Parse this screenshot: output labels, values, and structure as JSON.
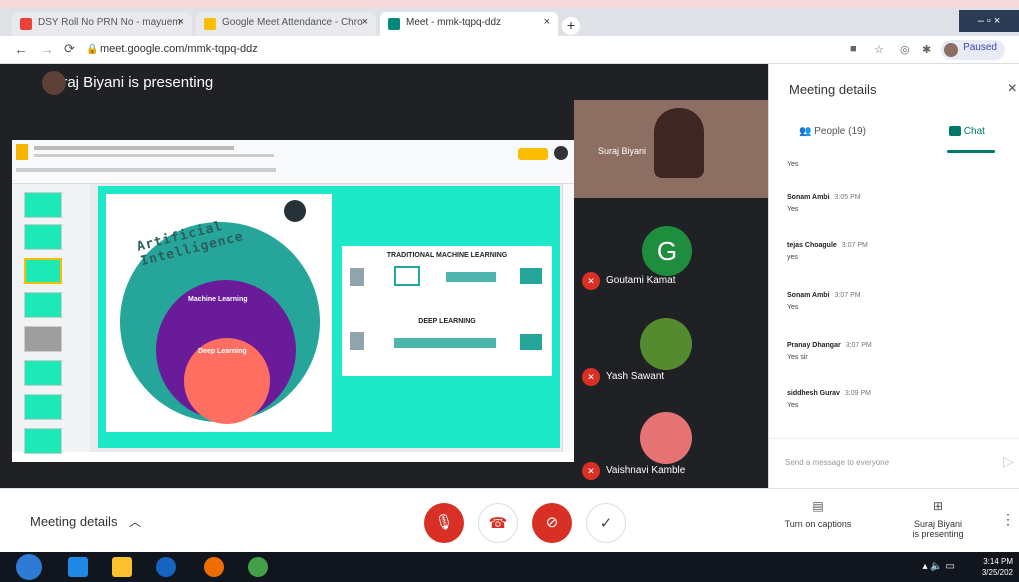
{
  "browser": {
    "tabs": [
      {
        "title": "DSY Roll No PRN No - mayuem"
      },
      {
        "title": "Google Meet Attendance - Chro"
      },
      {
        "title": "Meet - mmk-tqpq-ddz"
      }
    ],
    "new_tab": "+",
    "window_controls": "– ▫ ×",
    "url": "meet.google.com/mmk-tqpq-ddz",
    "profile_status": "Paused"
  },
  "meet": {
    "presenting_banner": "Suraj Biyani is presenting",
    "participants": [
      {
        "name": "Suraj Biyani"
      },
      {
        "name": "Goutami Kamat",
        "initial": "G"
      },
      {
        "name": "Yash Sawant"
      },
      {
        "name": "Vaishnavi Kamble"
      }
    ],
    "slide": {
      "title": "Artificial Intelligence",
      "inner_label_1": "Machine Learning",
      "inner_label_2": "Deep Learning",
      "panel_1_title": "TRADITIONAL MACHINE LEARNING",
      "panel_2_title": "DEEP LEARNING"
    }
  },
  "panel": {
    "title": "Meeting details",
    "close": "×",
    "tab_people": "People (19)",
    "tab_chat": "Chat",
    "messages": [
      {
        "text": "Yes"
      },
      {
        "sender": "Sonam Ambi",
        "time": "3:05 PM",
        "text": "Yes"
      },
      {
        "sender": "tejas Choagule",
        "time": "3:07 PM",
        "text": "yes"
      },
      {
        "sender": "Sonam Ambi",
        "time": "3:07 PM",
        "text": "Yes"
      },
      {
        "sender": "Pranay Dhangar",
        "time": "3:07 PM",
        "text": "Yes sir"
      },
      {
        "sender": "siddhesh Gurav",
        "time": "3:09 PM",
        "text": "Yes"
      }
    ],
    "input_placeholder": "Send a message to everyone"
  },
  "bottom": {
    "meeting_details": "Meeting details",
    "captions": "Turn on captions",
    "presenting_line1": "Suraj Biyani",
    "presenting_line2": "is presenting"
  },
  "taskbar": {
    "time": "3:14 PM",
    "date": "3/25/202"
  },
  "colors": {
    "meet_bg": "#202124",
    "red_control": "#d93025",
    "chat_accent": "#00796b",
    "slide_bg": "#1de9c8"
  }
}
